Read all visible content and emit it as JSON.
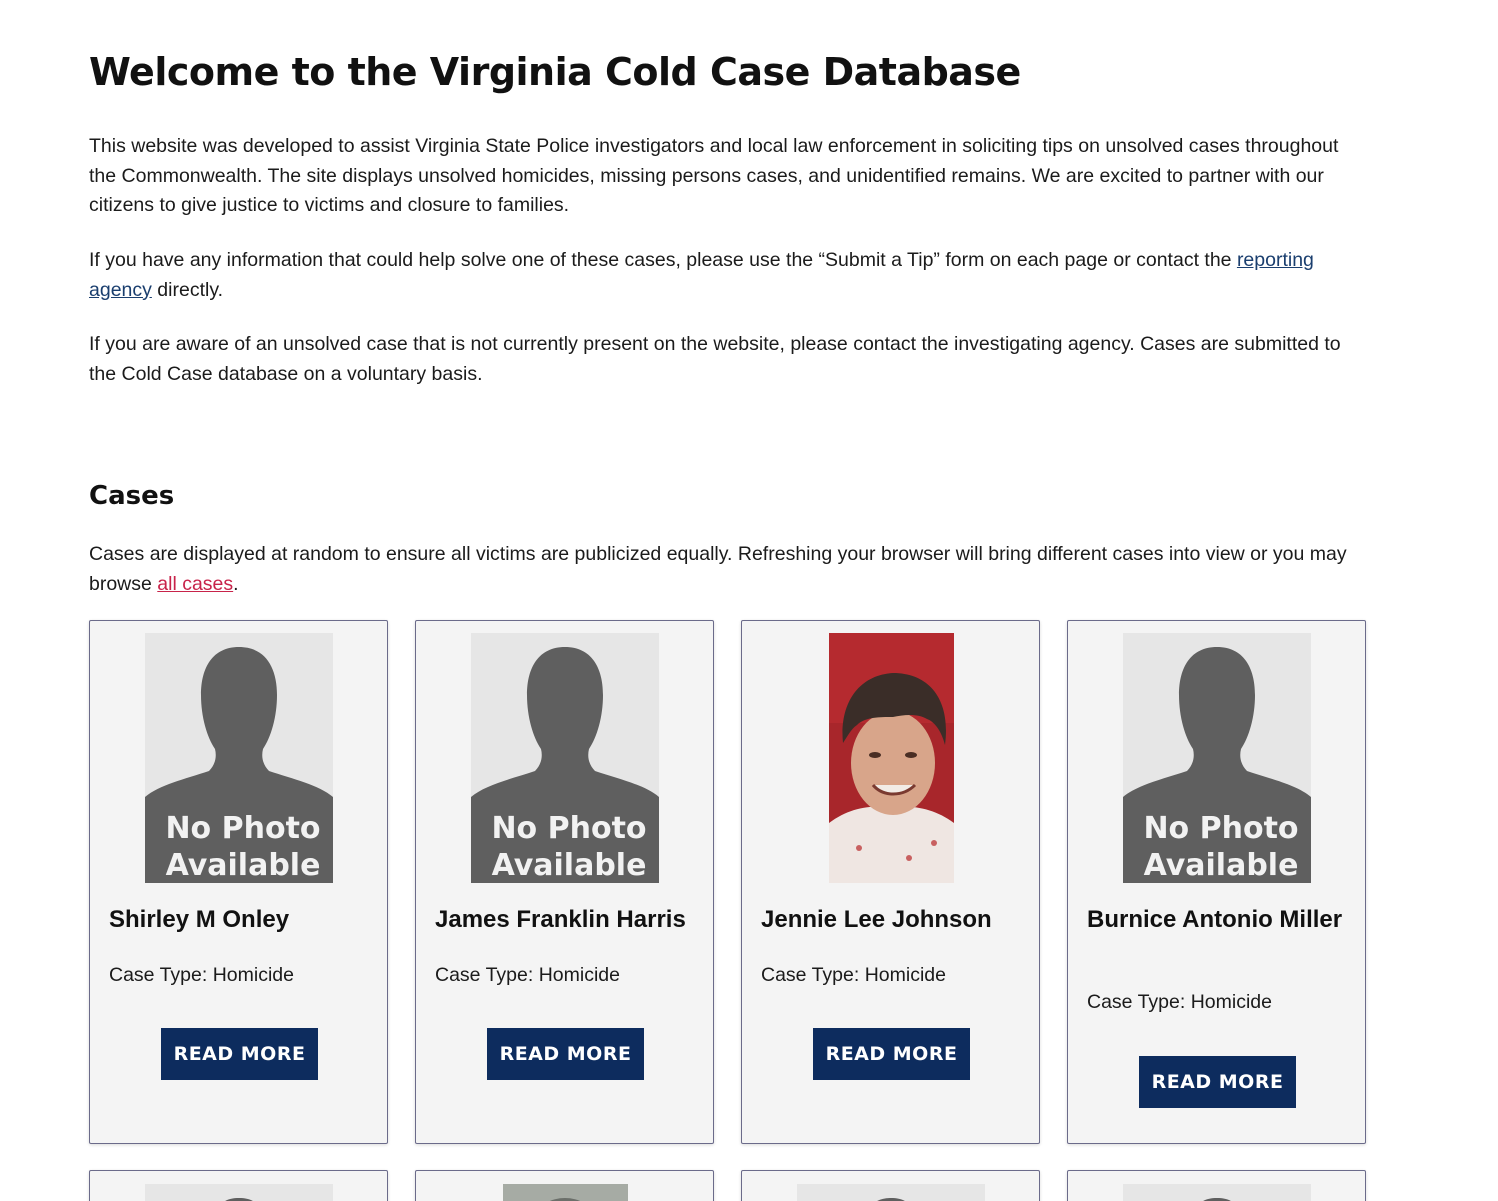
{
  "header": {
    "title": "Welcome to the Virginia Cold Case Database"
  },
  "intro": {
    "p1": "This website was developed to assist Virginia State Police investigators and local law enforcement in soliciting tips on unsolved cases throughout the Commonwealth.  The site displays unsolved homicides, missing persons cases, and unidentified remains.  We are excited to partner with our citizens to give justice to victims and closure to families.",
    "p2_before": "If you have any information that could help solve one of these cases, please use the “Submit a Tip” form on each page or contact the ",
    "p2_link": "reporting agency",
    "p2_after": " directly.",
    "p3": "If you are aware of an unsolved case that is not currently present on the website, please contact the investigating agency.  Cases are submitted to the Cold Case database on a voluntary basis."
  },
  "cases_section": {
    "title": "Cases",
    "desc_before": "Cases are displayed at random to ensure all victims are publicized equally. Refreshing your browser will bring different cases into view or you may browse ",
    "desc_link": "all cases",
    "desc_after": "."
  },
  "placeholder": {
    "line1": "No Photo",
    "line2": "Available"
  },
  "cards": [
    {
      "name": "Shirley M Onley",
      "case_type": "Case Type: Homicide",
      "button": "READ MORE",
      "photo": "no-photo"
    },
    {
      "name": "James Franklin Harris",
      "case_type": "Case Type: Homicide",
      "button": "READ MORE",
      "photo": "no-photo"
    },
    {
      "name": "Jennie Lee Johnson",
      "case_type": "Case Type: Homicide",
      "button": "READ MORE",
      "photo": "portrait"
    },
    {
      "name": "Burnice Antonio Miller",
      "case_type": "Case Type: Homicide",
      "button": "READ MORE",
      "photo": "no-photo"
    }
  ],
  "colors": {
    "button_bg": "#0d2c5e",
    "card_bg": "#f4f4f4",
    "link_blue": "#1a3e6e",
    "link_red": "#c8234a"
  }
}
